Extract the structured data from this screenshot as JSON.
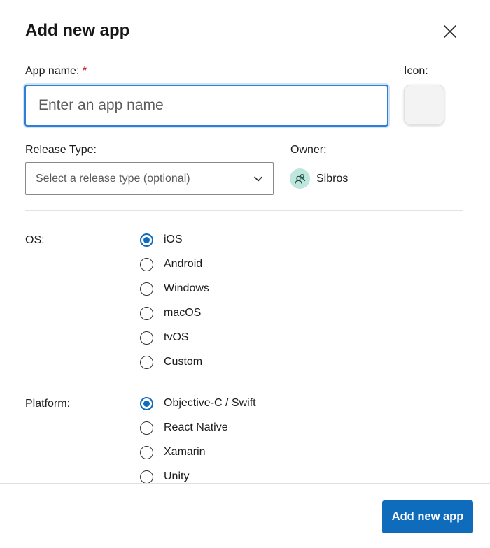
{
  "dialog": {
    "title": "Add new app",
    "close_icon": "close-icon"
  },
  "app_name": {
    "label": "App name:",
    "required_marker": "*",
    "placeholder": "Enter an app name",
    "value": ""
  },
  "icon": {
    "label": "Icon:"
  },
  "release_type": {
    "label": "Release Type:",
    "placeholder": "Select a release type (optional)",
    "icon": "chevron-down-icon"
  },
  "owner": {
    "label": "Owner:",
    "name": "Sibros",
    "icon": "people-icon"
  },
  "os": {
    "label": "OS:",
    "options": [
      "iOS",
      "Android",
      "Windows",
      "macOS",
      "tvOS",
      "Custom"
    ],
    "selected": "iOS"
  },
  "platform": {
    "label": "Platform:",
    "options": [
      "Objective-C / Swift",
      "React Native",
      "Xamarin",
      "Unity"
    ],
    "selected": "Objective-C / Swift"
  },
  "footer": {
    "submit_label": "Add new app"
  },
  "colors": {
    "accent": "#0f6cbd",
    "focus_border": "#2f7fd4",
    "required": "#c50f1f",
    "avatar_bg": "#bfe6dd"
  }
}
